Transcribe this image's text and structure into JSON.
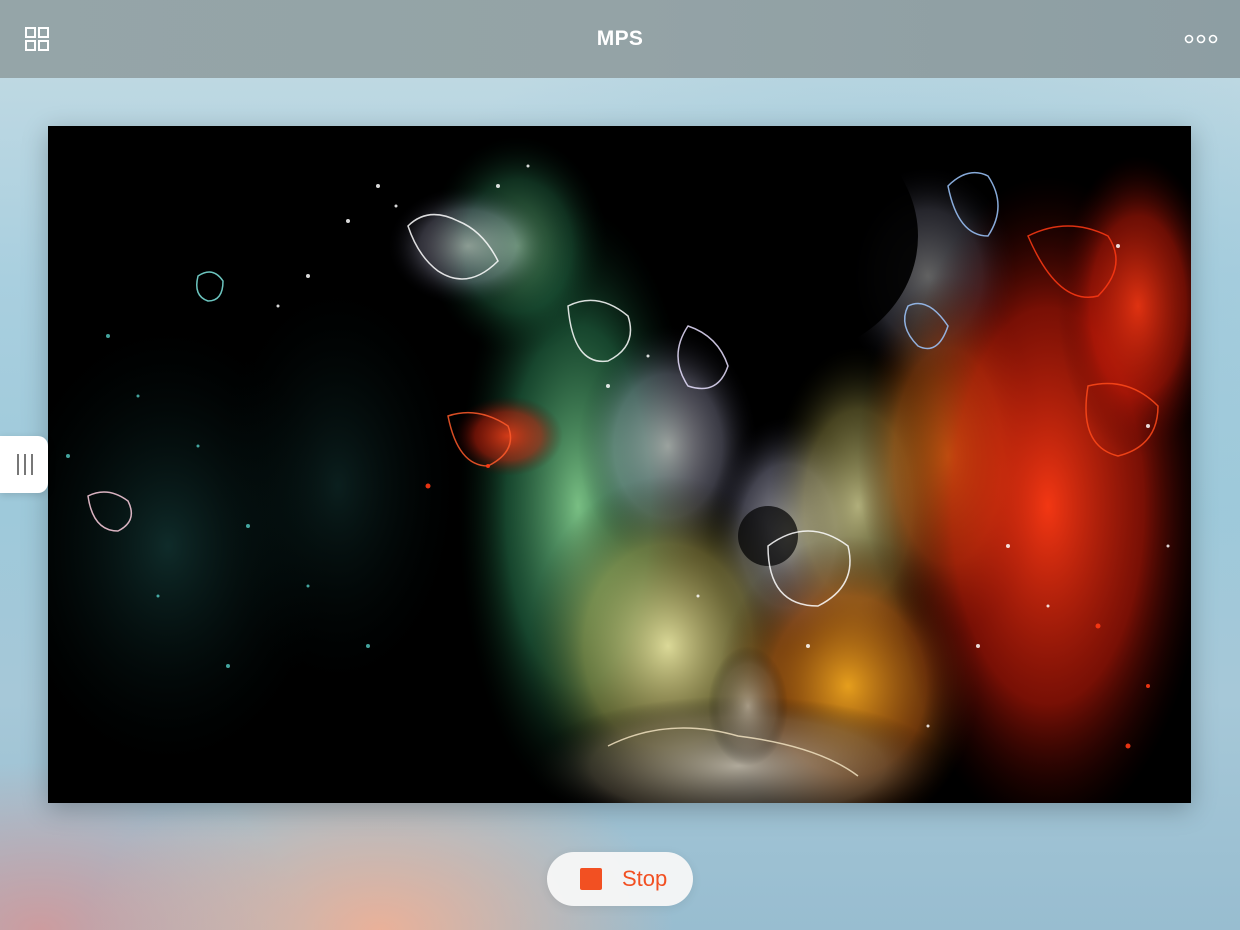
{
  "app": {
    "title": "MPS"
  },
  "toolbar": {
    "left_icon": "grid-icon",
    "right_icon": "more-dots-icon"
  },
  "viewer": {
    "content": "edge-detection-filtered-autumn-forest-path-image"
  },
  "side_panel": {
    "handle_icon": "drag-handle-icon"
  },
  "controls": {
    "stop_label": "Stop",
    "stop_icon": "stop-square-icon",
    "accent_color": "#f25022"
  },
  "colors": {
    "toolbar_bg": "#95a5a8",
    "toolbar_text": "#ffffff",
    "accent": "#f25022"
  }
}
